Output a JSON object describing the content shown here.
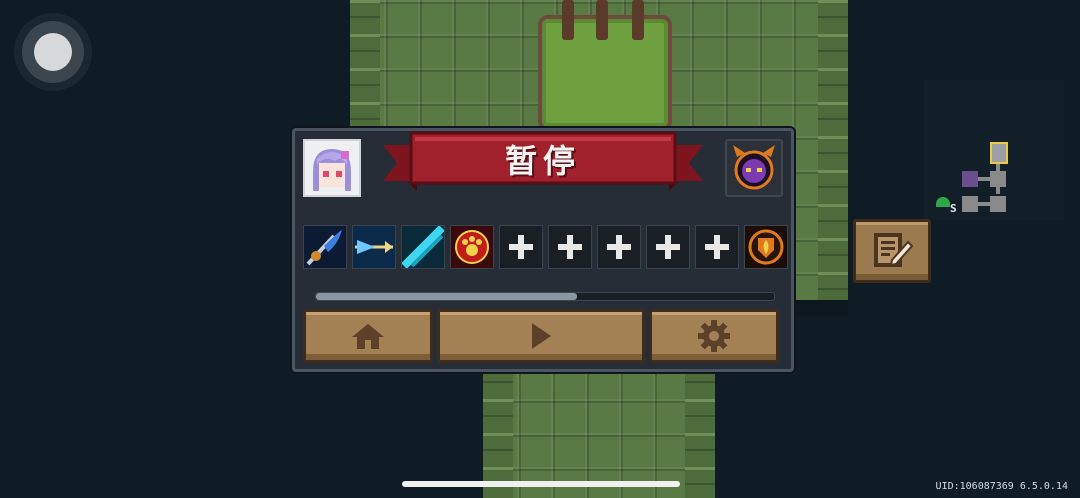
{
  "pause_menu": {
    "title": "暂停",
    "progress_fraction": 0.57,
    "skills": [
      {
        "icon": "drill-lance-icon",
        "filled": true
      },
      {
        "icon": "energy-arrow-icon",
        "filled": true
      },
      {
        "icon": "cyan-slash-icon",
        "filled": true
      },
      {
        "icon": "paw-print-icon",
        "filled": true
      },
      {
        "icon": "plus-icon",
        "filled": false
      },
      {
        "icon": "plus-icon",
        "filled": false
      },
      {
        "icon": "plus-icon",
        "filled": false
      },
      {
        "icon": "plus-icon",
        "filled": false
      },
      {
        "icon": "plus-icon",
        "filled": false
      },
      {
        "icon": "flame-shield-icon",
        "filled": true
      }
    ],
    "buttons": [
      {
        "name": "home-button",
        "icon": "home-icon"
      },
      {
        "name": "resume-button",
        "icon": "play-icon"
      },
      {
        "name": "settings-button",
        "icon": "gear-icon"
      }
    ]
  },
  "minimap": {
    "portal_label": "S"
  },
  "footer": {
    "uid_text": "UID:106087369 6.5.0.14"
  },
  "colors": {
    "banner_red": "#a0202c",
    "button_tan": "#a38155",
    "panel_bg": "#262d36"
  }
}
